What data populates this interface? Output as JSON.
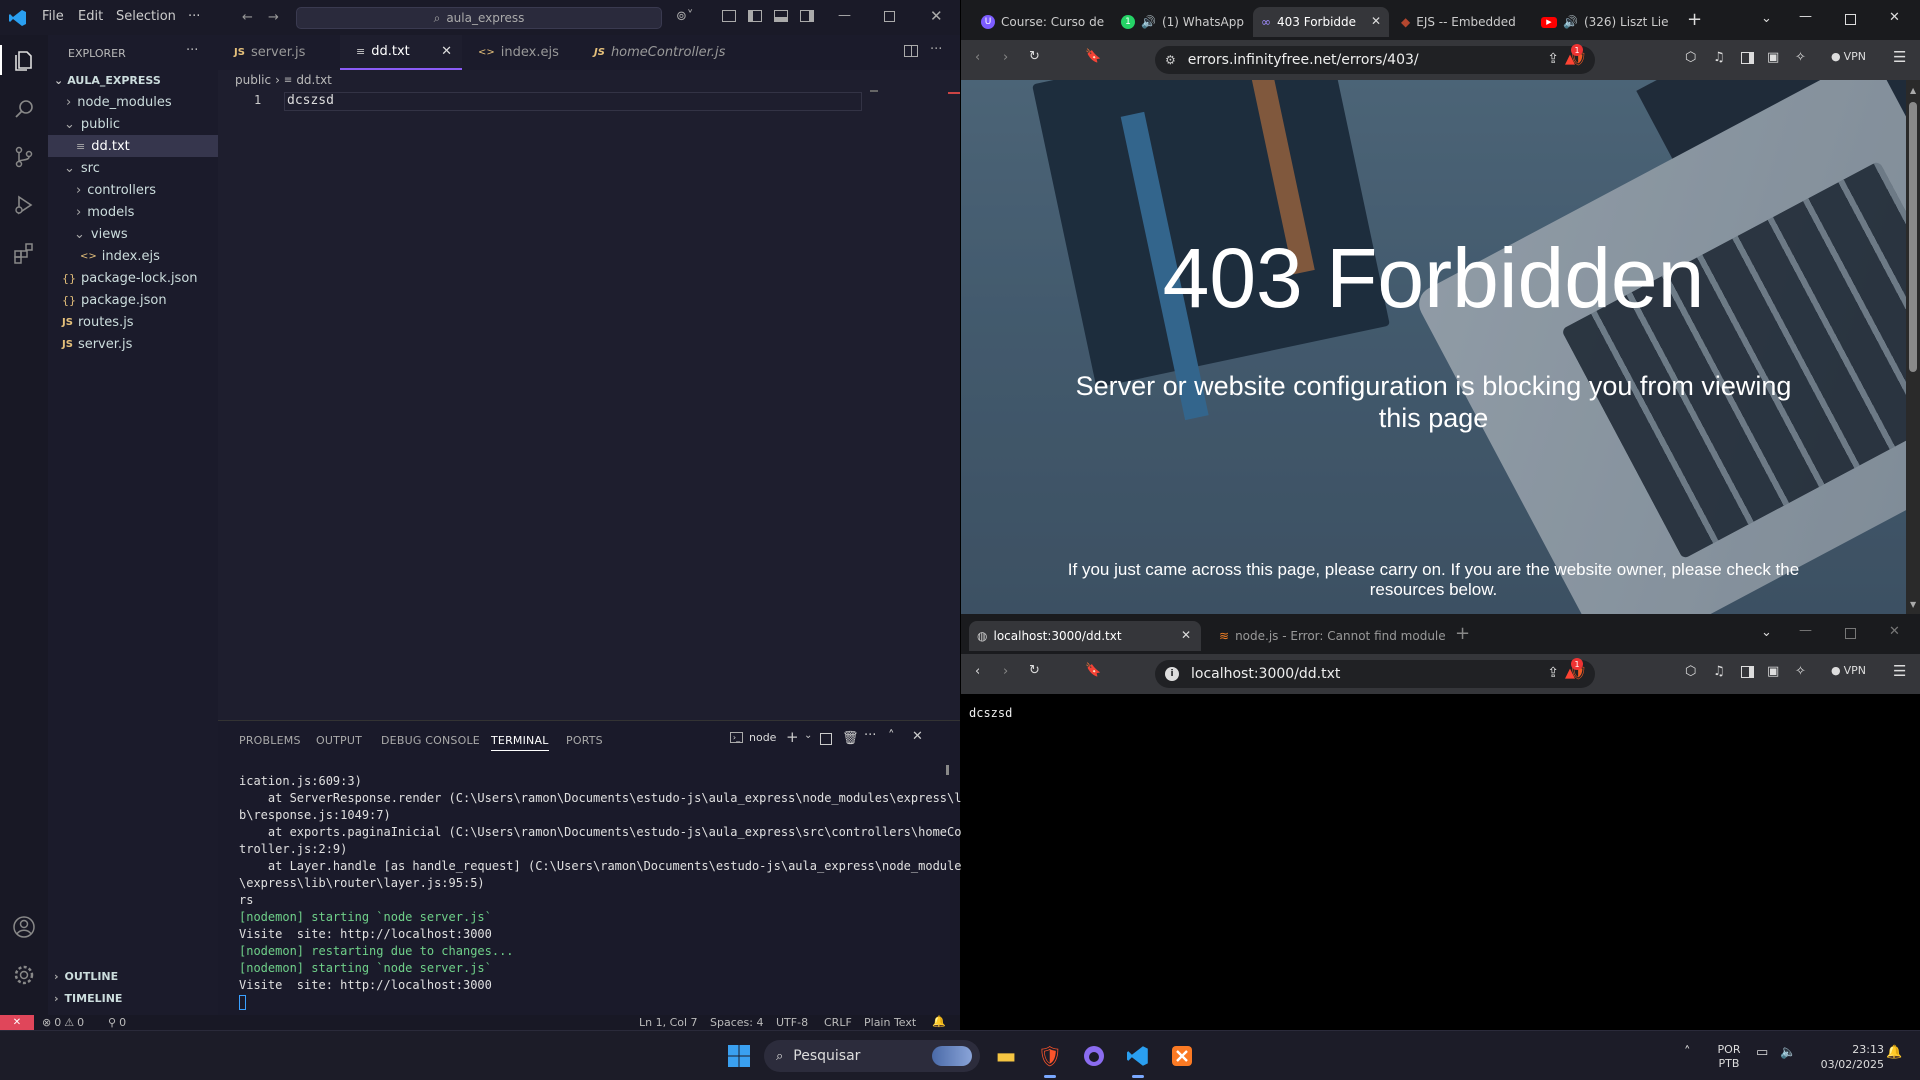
{
  "vscode": {
    "menus": [
      "File",
      "Edit",
      "Selection",
      "···"
    ],
    "search": "aula_express",
    "explorer_title": "EXPLORER",
    "explorer_more": "···",
    "project": "AULA_EXPRESS",
    "tree": [
      {
        "label": "node_modules",
        "type": "folder-closed"
      },
      {
        "label": "public",
        "type": "folder-open"
      },
      {
        "label": "dd.txt",
        "type": "file-txt",
        "selected": true
      },
      {
        "label": "src",
        "type": "folder-open"
      },
      {
        "label": "controllers",
        "type": "folder-closed"
      },
      {
        "label": "models",
        "type": "folder-closed"
      },
      {
        "label": "views",
        "type": "folder-open"
      },
      {
        "label": "index.ejs",
        "type": "file-ejs"
      },
      {
        "label": "package-lock.json",
        "type": "file-json"
      },
      {
        "label": "package.json",
        "type": "file-json"
      },
      {
        "label": "routes.js",
        "type": "file-js"
      },
      {
        "label": "server.js",
        "type": "file-js"
      }
    ],
    "outline": "OUTLINE",
    "timeline": "TIMELINE",
    "tabs": [
      {
        "label": "server.js",
        "icon": "JS"
      },
      {
        "label": "dd.txt",
        "icon": "≡",
        "active": true
      },
      {
        "label": "index.ejs",
        "icon": "<>"
      },
      {
        "label": "homeController.js",
        "icon": "JS"
      }
    ],
    "breadcrumb": {
      "folder": "public",
      "file": "dd.txt"
    },
    "editor": {
      "line_number": "1",
      "line_text": "dcszsd"
    },
    "panel_tabs": [
      "PROBLEMS",
      "OUTPUT",
      "DEBUG CONSOLE",
      "TERMINAL",
      "PORTS"
    ],
    "terminal_name": "node",
    "terminal_lines": [
      {
        "text": "ication.js:609:3)",
        "green": false
      },
      {
        "text": "    at ServerResponse.render (C:\\Users\\ramon\\Documents\\estudo-js\\aula_express\\node_modules\\express\\li",
        "green": false
      },
      {
        "text": "b\\response.js:1049:7)",
        "green": false
      },
      {
        "text": "    at exports.paginaInicial (C:\\Users\\ramon\\Documents\\estudo-js\\aula_express\\src\\controllers\\homeCon",
        "green": false
      },
      {
        "text": "troller.js:2:9)",
        "green": false
      },
      {
        "text": "    at Layer.handle [as handle_request] (C:\\Users\\ramon\\Documents\\estudo-js\\aula_express\\node_modules",
        "green": false
      },
      {
        "text": "\\express\\lib\\router\\layer.js:95:5)",
        "green": false
      },
      {
        "text": "rs",
        "green": false
      },
      {
        "text": "[nodemon] starting `node server.js`",
        "green": true
      },
      {
        "text": "Visite  site: http://localhost:3000",
        "green": false
      },
      {
        "text": "[nodemon] restarting due to changes...",
        "green": true
      },
      {
        "text": "[nodemon] starting `node server.js`",
        "green": true
      },
      {
        "text": "Visite  site: http://localhost:3000",
        "green": false
      }
    ],
    "status": {
      "errors": "0",
      "warnings": "0",
      "ports": "0",
      "position": "Ln 1, Col 7",
      "spaces": "Spaces: 4",
      "encoding": "UTF-8",
      "eol": "CRLF",
      "language": "Plain Text"
    }
  },
  "browser_top": {
    "tabs": [
      {
        "label": "Course: Curso de"
      },
      {
        "label": "(1) WhatsApp"
      },
      {
        "label": "403 Forbidde",
        "active": true
      },
      {
        "label": "EJS -- Embedded"
      },
      {
        "label": "(326) Liszt Lie"
      }
    ],
    "url": "errors.infinityfree.net/errors/403/",
    "vpn": "VPN",
    "badge": "1",
    "page": {
      "title": "403 Forbidden",
      "subtitle": "Server or website configuration is blocking you from viewing this page",
      "note": "If you just came across this page, please carry on. If you are the website owner, please check the resources below."
    }
  },
  "browser_bottom": {
    "tabs": [
      {
        "label": "localhost:3000/dd.txt",
        "active": true
      },
      {
        "label": "node.js - Error: Cannot find module"
      }
    ],
    "url": "localhost:3000/dd.txt",
    "vpn": "VPN",
    "badge": "1",
    "content": "dcszsd"
  },
  "taskbar": {
    "search": "Pesquisar",
    "lang_top": "POR",
    "lang_bottom": "PTB",
    "time": "23:13",
    "date": "03/02/2025"
  }
}
